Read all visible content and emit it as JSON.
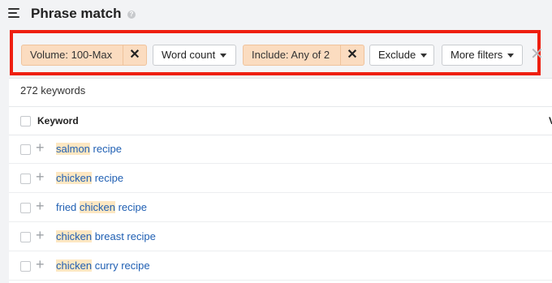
{
  "header": {
    "title": "Phrase match",
    "menu_icon": "hamburger-menu-icon",
    "help_icon": "help-circle-icon"
  },
  "filters": {
    "volume": "Volume: 100-Max",
    "word_count": "Word count",
    "include": "Include: Any of 2",
    "exclude": "Exclude",
    "more": "More filters",
    "remove_glyph": "✕",
    "clear_glyph": "✕"
  },
  "table": {
    "count_label": "272 keywords",
    "column_header": "Keyword",
    "column_header_clipped": "V",
    "rows": [
      {
        "pre": "",
        "hl": "salmon",
        "post": " recipe"
      },
      {
        "pre": "",
        "hl": "chicken",
        "post": " recipe"
      },
      {
        "pre": "fried ",
        "hl": "chicken",
        "post": " recipe"
      },
      {
        "pre": "",
        "hl": "chicken",
        "post": " breast recipe"
      },
      {
        "pre": "",
        "hl": "chicken",
        "post": " curry recipe"
      }
    ]
  },
  "colors": {
    "highlight_border": "#ee1f10",
    "active_chip": "#fbdcc0",
    "link": "#1f5fb3",
    "keyword_highlight": "#fde7c2"
  }
}
